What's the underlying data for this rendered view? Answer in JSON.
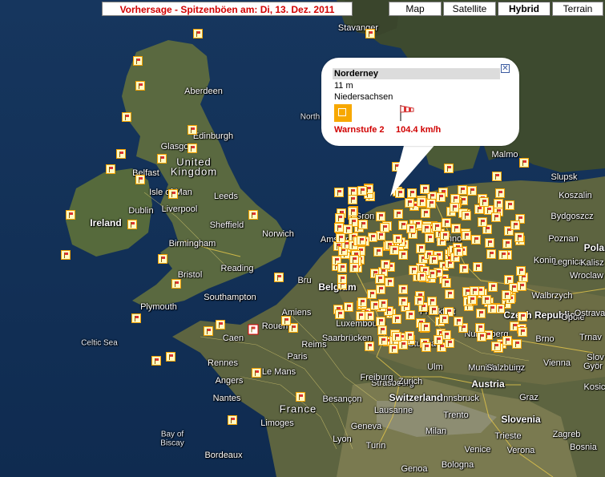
{
  "title": "Vorhersage - Spitzenböen am: Di, 13. Dez. 2011",
  "map_types": [
    {
      "label": "Map",
      "active": false
    },
    {
      "label": "Satellite",
      "active": false
    },
    {
      "label": "Hybrid",
      "active": true
    },
    {
      "label": "Terrain",
      "active": false
    }
  ],
  "colors": {
    "title_text": "#d00000",
    "warning": "#d00000",
    "station_border": "#f2a100",
    "selected_station": "#e00000"
  },
  "info_window": {
    "station": "Norderney",
    "elevation": "11 m",
    "state": "Niedersachsen",
    "warn_icon": "warning-level-icon",
    "wind_icon": "windsock-icon",
    "warning_level": "Warnstufe 2",
    "wind_speed": "104.4  km/h",
    "close_icon": "close-icon"
  },
  "places": [
    {
      "name": "Stavanger",
      "type": "city"
    },
    {
      "name": "Aberdeen",
      "type": "city"
    },
    {
      "name": "North",
      "type": "sea"
    },
    {
      "name": "Edinburgh",
      "type": "city"
    },
    {
      "name": "Glasgow",
      "type": "city"
    },
    {
      "name": "United",
      "type": "big"
    },
    {
      "name": "Kingdom",
      "type": "big"
    },
    {
      "name": "Belfast",
      "type": "city"
    },
    {
      "name": "Isle of Man",
      "type": "city"
    },
    {
      "name": "Leeds",
      "type": "city"
    },
    {
      "name": "Dublin",
      "type": "city"
    },
    {
      "name": "Liverpool",
      "type": "city"
    },
    {
      "name": "Ireland",
      "type": "country"
    },
    {
      "name": "Sheffield",
      "type": "city"
    },
    {
      "name": "Norwich",
      "type": "city"
    },
    {
      "name": "Birmingham",
      "type": "city"
    },
    {
      "name": "Amsterdam",
      "type": "city"
    },
    {
      "name": "Reading",
      "type": "city"
    },
    {
      "name": "Bristol",
      "type": "city"
    },
    {
      "name": "Southampton",
      "type": "city"
    },
    {
      "name": "Belgium",
      "type": "country"
    },
    {
      "name": "Plymouth",
      "type": "city"
    },
    {
      "name": "Amiens",
      "type": "city"
    },
    {
      "name": "Celtic Sea",
      "type": "sea"
    },
    {
      "name": "Rouen",
      "type": "city"
    },
    {
      "name": "Caen",
      "type": "city"
    },
    {
      "name": "Luxembourg",
      "type": "city"
    },
    {
      "name": "Reims",
      "type": "city"
    },
    {
      "name": "Saarbrücken",
      "type": "city"
    },
    {
      "name": "Paris",
      "type": "city"
    },
    {
      "name": "Rennes",
      "type": "city"
    },
    {
      "name": "Angers",
      "type": "city"
    },
    {
      "name": "Le Mans",
      "type": "city"
    },
    {
      "name": "Nantes",
      "type": "city"
    },
    {
      "name": "France",
      "type": "big"
    },
    {
      "name": "Limoges",
      "type": "city"
    },
    {
      "name": "Bay of",
      "type": "sea"
    },
    {
      "name": "Biscay",
      "type": "sea"
    },
    {
      "name": "Bordeaux",
      "type": "city"
    },
    {
      "name": "Besançon",
      "type": "city"
    },
    {
      "name": "Lyon",
      "type": "city"
    },
    {
      "name": "Geneva",
      "type": "city"
    },
    {
      "name": "Turin",
      "type": "city"
    },
    {
      "name": "Milan",
      "type": "city"
    },
    {
      "name": "Strasbourg",
      "type": "city"
    },
    {
      "name": "Stuttgart",
      "type": "city"
    },
    {
      "name": "Frankfurt",
      "type": "city"
    },
    {
      "name": "Freiburg",
      "type": "city"
    },
    {
      "name": "Zurich",
      "type": "city"
    },
    {
      "name": "Switzerland",
      "type": "country"
    },
    {
      "name": "Lausanne",
      "type": "city"
    },
    {
      "name": "Ulm",
      "type": "city"
    },
    {
      "name": "Munich",
      "type": "city"
    },
    {
      "name": "Nuremberg",
      "type": "city"
    },
    {
      "name": "Innsbruck",
      "type": "city"
    },
    {
      "name": "Austria",
      "type": "country"
    },
    {
      "name": "Salzburg",
      "type": "city"
    },
    {
      "name": "Linz",
      "type": "city"
    },
    {
      "name": "Brno",
      "type": "city"
    },
    {
      "name": "Vienna",
      "type": "city"
    },
    {
      "name": "Graz",
      "type": "city"
    },
    {
      "name": "Slovenia",
      "type": "country"
    },
    {
      "name": "Trento",
      "type": "city"
    },
    {
      "name": "Trieste",
      "type": "city"
    },
    {
      "name": "Venice",
      "type": "city"
    },
    {
      "name": "Verona",
      "type": "city"
    },
    {
      "name": "Bologna",
      "type": "city"
    },
    {
      "name": "Genoa",
      "type": "city"
    },
    {
      "name": "Zagreb",
      "type": "city"
    },
    {
      "name": "Bosnia",
      "type": "city"
    },
    {
      "name": "Czech Republic",
      "type": "country"
    },
    {
      "name": "Wroclaw",
      "type": "city"
    },
    {
      "name": "Legnica",
      "type": "city"
    },
    {
      "name": "Walbrzych",
      "type": "city"
    },
    {
      "name": "Opole",
      "type": "city"
    },
    {
      "name": "Ostrava",
      "type": "city"
    },
    {
      "name": "Kalisz",
      "type": "city"
    },
    {
      "name": "Konin",
      "type": "city"
    },
    {
      "name": "Poznan",
      "type": "city"
    },
    {
      "name": "Bydgoszcz",
      "type": "city"
    },
    {
      "name": "Koszalin",
      "type": "city"
    },
    {
      "name": "Slupsk",
      "type": "city"
    },
    {
      "name": "Polan",
      "type": "country"
    },
    {
      "name": "Malmo",
      "type": "city"
    },
    {
      "name": "Gron",
      "type": "city"
    },
    {
      "name": "Hanno",
      "type": "city"
    },
    {
      "name": "Bru",
      "type": "city"
    },
    {
      "name": "Trnav",
      "type": "city"
    },
    {
      "name": "Györ",
      "type": "city"
    },
    {
      "name": "Kosice",
      "type": "city"
    },
    {
      "name": "Slov",
      "type": "city"
    }
  ]
}
